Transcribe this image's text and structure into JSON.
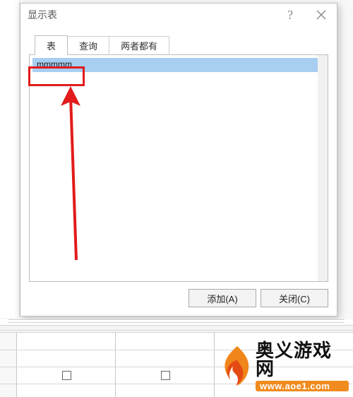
{
  "dialog": {
    "title": "显示表",
    "help_label": "?",
    "tabs": [
      {
        "label": "表",
        "active": true
      },
      {
        "label": "查询",
        "active": false
      },
      {
        "label": "两者都有",
        "active": false
      }
    ],
    "list": {
      "items": [
        "mmmmm"
      ],
      "selected_index": 0
    },
    "buttons": {
      "add": "添加(A)",
      "close": "关闭(C)"
    }
  },
  "watermark": {
    "name_cn": "奥义游戏网",
    "url": "www.aoe1.com"
  },
  "annotation_color": "#e21b1b"
}
